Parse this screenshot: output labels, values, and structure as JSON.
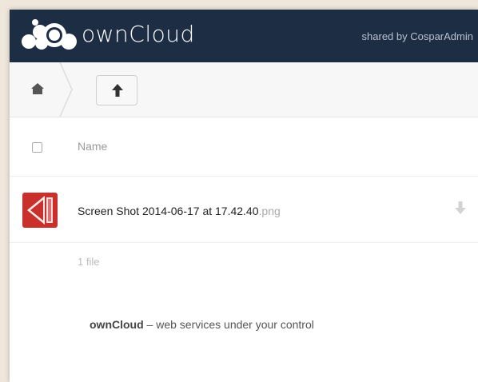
{
  "header": {
    "logo_text": "ownCloud",
    "shared_by": "shared by CosparAdmin",
    "color": "#1d2d44"
  },
  "controls": {
    "home_icon": "home-icon",
    "up_icon": "arrow-up-icon"
  },
  "table": {
    "name_header": "Name",
    "files": [
      {
        "basename": "Screen Shot 2014-06-17 at 17.42.40",
        "extension": ".png",
        "thumbnail_icon": "image-thumbnail-icon",
        "thumbnail_color": "#c9302c",
        "action_icon": "download-icon"
      }
    ],
    "summary": "1 file"
  },
  "footer": {
    "brand": "ownCloud",
    "tagline": " – web services under your control"
  }
}
